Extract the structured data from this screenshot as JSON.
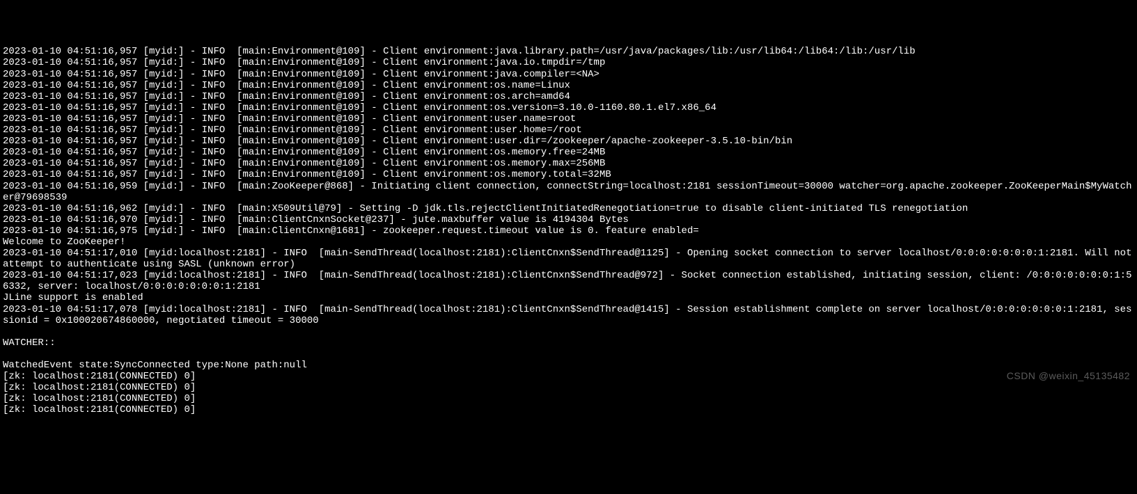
{
  "terminal": {
    "lines": [
      "2023-01-10 04:51:16,957 [myid:] - INFO  [main:Environment@109] - Client environment:java.library.path=/usr/java/packages/lib:/usr/lib64:/lib64:/lib:/usr/lib",
      "2023-01-10 04:51:16,957 [myid:] - INFO  [main:Environment@109] - Client environment:java.io.tmpdir=/tmp",
      "2023-01-10 04:51:16,957 [myid:] - INFO  [main:Environment@109] - Client environment:java.compiler=<NA>",
      "2023-01-10 04:51:16,957 [myid:] - INFO  [main:Environment@109] - Client environment:os.name=Linux",
      "2023-01-10 04:51:16,957 [myid:] - INFO  [main:Environment@109] - Client environment:os.arch=amd64",
      "2023-01-10 04:51:16,957 [myid:] - INFO  [main:Environment@109] - Client environment:os.version=3.10.0-1160.80.1.el7.x86_64",
      "2023-01-10 04:51:16,957 [myid:] - INFO  [main:Environment@109] - Client environment:user.name=root",
      "2023-01-10 04:51:16,957 [myid:] - INFO  [main:Environment@109] - Client environment:user.home=/root",
      "2023-01-10 04:51:16,957 [myid:] - INFO  [main:Environment@109] - Client environment:user.dir=/zookeeper/apache-zookeeper-3.5.10-bin/bin",
      "2023-01-10 04:51:16,957 [myid:] - INFO  [main:Environment@109] - Client environment:os.memory.free=24MB",
      "2023-01-10 04:51:16,957 [myid:] - INFO  [main:Environment@109] - Client environment:os.memory.max=256MB",
      "2023-01-10 04:51:16,957 [myid:] - INFO  [main:Environment@109] - Client environment:os.memory.total=32MB",
      "2023-01-10 04:51:16,959 [myid:] - INFO  [main:ZooKeeper@868] - Initiating client connection, connectString=localhost:2181 sessionTimeout=30000 watcher=org.apache.zookeeper.ZooKeeperMain$MyWatcher@79698539",
      "2023-01-10 04:51:16,962 [myid:] - INFO  [main:X509Util@79] - Setting -D jdk.tls.rejectClientInitiatedRenegotiation=true to disable client-initiated TLS renegotiation",
      "2023-01-10 04:51:16,970 [myid:] - INFO  [main:ClientCnxnSocket@237] - jute.maxbuffer value is 4194304 Bytes",
      "2023-01-10 04:51:16,975 [myid:] - INFO  [main:ClientCnxn@1681] - zookeeper.request.timeout value is 0. feature enabled=",
      "Welcome to ZooKeeper!",
      "2023-01-10 04:51:17,010 [myid:localhost:2181] - INFO  [main-SendThread(localhost:2181):ClientCnxn$SendThread@1125] - Opening socket connection to server localhost/0:0:0:0:0:0:0:1:2181. Will not attempt to authenticate using SASL (unknown error)",
      "2023-01-10 04:51:17,023 [myid:localhost:2181] - INFO  [main-SendThread(localhost:2181):ClientCnxn$SendThread@972] - Socket connection established, initiating session, client: /0:0:0:0:0:0:0:1:56332, server: localhost/0:0:0:0:0:0:0:1:2181",
      "JLine support is enabled",
      "2023-01-10 04:51:17,078 [myid:localhost:2181] - INFO  [main-SendThread(localhost:2181):ClientCnxn$SendThread@1415] - Session establishment complete on server localhost/0:0:0:0:0:0:0:1:2181, sessionid = 0x100020674860000, negotiated timeout = 30000",
      "",
      "WATCHER::",
      "",
      "WatchedEvent state:SyncConnected type:None path:null",
      "[zk: localhost:2181(CONNECTED) 0]",
      "[zk: localhost:2181(CONNECTED) 0]",
      "[zk: localhost:2181(CONNECTED) 0]",
      "[zk: localhost:2181(CONNECTED) 0]"
    ]
  },
  "watermark": "CSDN @weixin_45135482"
}
